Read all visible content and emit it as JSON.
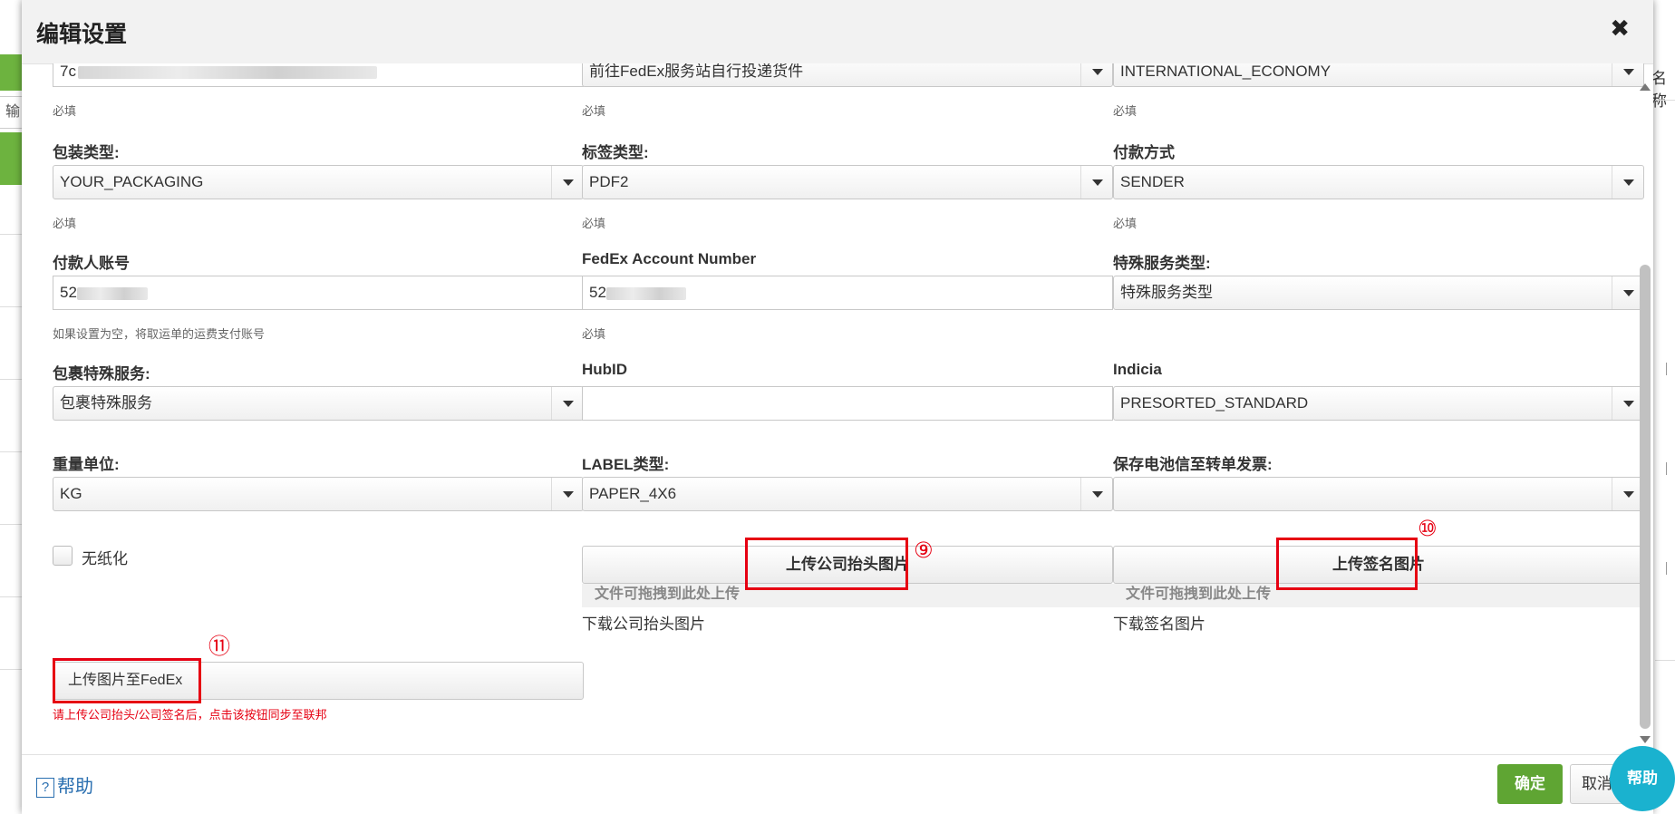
{
  "dialog": {
    "title": "编辑设置"
  },
  "top_row": {
    "col1": {
      "value_prefix": "7c",
      "hint": "必填"
    },
    "col2": {
      "value": "前往FedEx服务站自行投递货件",
      "hint": "必填"
    },
    "col3": {
      "value": "INTERNATIONAL_ECONOMY",
      "hint": "必填"
    }
  },
  "packaging": {
    "label": "包装类型:",
    "value": "YOUR_PACKAGING",
    "hint": "必填"
  },
  "label_type": {
    "label": "标签类型:",
    "value": "PDF2",
    "hint": "必填"
  },
  "payment": {
    "label": "付款方式",
    "value": "SENDER",
    "hint": "必填"
  },
  "payer_account": {
    "label": "付款人账号",
    "value_prefix": "52",
    "hint": "如果设置为空，将取运单的运费支付账号"
  },
  "fedex_account": {
    "label": "FedEx Account Number",
    "value_prefix": "52",
    "hint": "必填"
  },
  "special_service": {
    "label": "特殊服务类型:",
    "placeholder": "特殊服务类型"
  },
  "package_service": {
    "label": "包裹特殊服务:",
    "placeholder": "包裹特殊服务"
  },
  "hubid": {
    "label": "HubID",
    "value": ""
  },
  "indicia": {
    "label": "Indicia",
    "value": "PRESORTED_STANDARD"
  },
  "weight_unit": {
    "label": "重量单位:",
    "value": "KG"
  },
  "label_format": {
    "label": "LABEL类型:",
    "value": "PAPER_4X6"
  },
  "battery_invoice": {
    "label": "保存电池信至转单发票:",
    "value": ""
  },
  "paperless": {
    "label": "无纸化"
  },
  "letterhead": {
    "button": "上传公司抬头图片",
    "drop_hint": "文件可拖拽到此处上传",
    "download": "下载公司抬头图片",
    "annotation": "⑨"
  },
  "signature": {
    "button": "上传签名图片",
    "drop_hint": "文件可拖拽到此处上传",
    "download": "下载签名图片",
    "annotation": "⑩"
  },
  "fedex_upload": {
    "button": "上传图片至FedEx",
    "hint": "请上传公司抬头/公司签名后，点击该按钮同步至联邦",
    "annotation": "⑪"
  },
  "footer": {
    "help": "帮助",
    "help_q": "?",
    "ok": "确定",
    "cancel": "取消",
    "help_bubble": "帮助"
  },
  "background": {
    "left_input": "输",
    "right_header": "名称"
  },
  "colors": {
    "accent_green": "#5fa533",
    "annotation_red": "#e60012",
    "help_bubble": "#1ab2cf"
  },
  "icons": [
    "close-icon",
    "chevron-down-icon",
    "question-icon",
    "scroll-up-icon",
    "scroll-down-icon"
  ]
}
